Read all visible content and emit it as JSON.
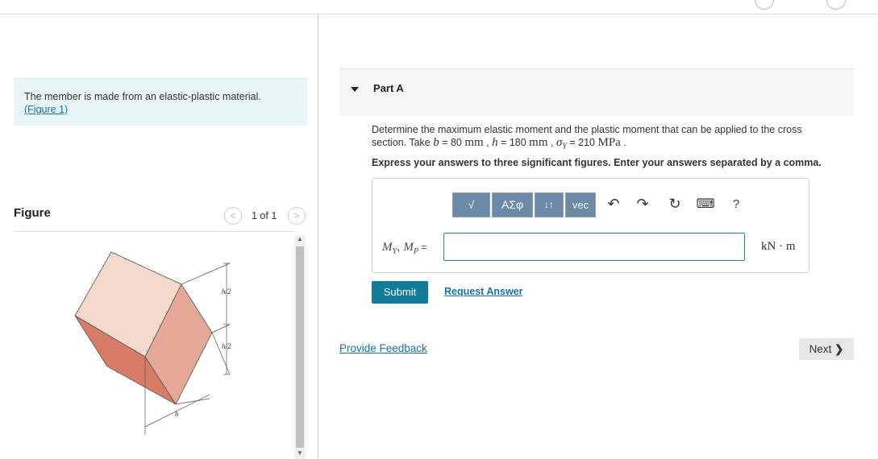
{
  "intro": {
    "text": "The member is made from an elastic-plastic material.",
    "figure_link": "(Figure 1)"
  },
  "figure_panel": {
    "title": "Figure",
    "counter": "1 of 1",
    "prev_icon": "<",
    "next_icon": ">",
    "labels": {
      "h_half_top": "h/2",
      "h_half_bottom": "h/2",
      "b": "b"
    }
  },
  "part": {
    "caret_icon": "triangle-down-icon",
    "title": "Part A"
  },
  "question": {
    "line1": "Determine the maximum elastic moment and the plastic moment that can be applied to the cross",
    "line2_prefix": "section. Take ",
    "b_var": "b",
    "b_val": " = 80 ",
    "b_unit": "mm",
    "h_var": "h",
    "h_val": " = 180 ",
    "h_unit": "mm",
    "sy_var": "σ",
    "sy_sub": "Y",
    "sy_val": " = 210 ",
    "sy_unit": "MPa",
    "instruction": "Express your answers to three significant figures. Enter your answers separated by a comma."
  },
  "toolbar": {
    "templates_label": "√",
    "greek_label": "ΑΣφ",
    "arrows_label": "↓↑",
    "vec_label": "vec",
    "undo_icon": "↶",
    "redo_icon": "↷",
    "reset_icon": "↻",
    "keyboard_icon": "⌨",
    "help_label": "?"
  },
  "answer": {
    "label_m1": "M",
    "label_s1": "Y",
    "label_m2": "M",
    "label_s2": "P",
    "label_eq": " =",
    "value": "",
    "unit": "kN · m"
  },
  "actions": {
    "submit": "Submit",
    "request": "Request Answer",
    "feedback": "Provide Feedback",
    "next": "Next"
  },
  "colors": {
    "accent": "#0f7c9a",
    "link": "#1a6fa3",
    "intro_bg": "#e8f6f8",
    "toolbar_btn": "#6a8aa8"
  }
}
